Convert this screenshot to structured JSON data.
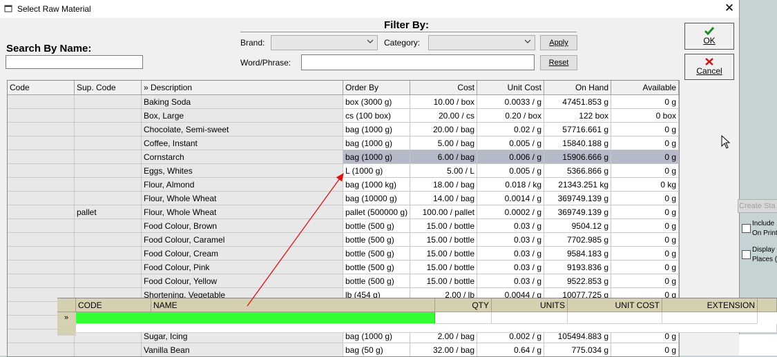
{
  "window": {
    "title": "Select Raw Material",
    "close_glyph": "✕"
  },
  "search": {
    "label": "Search By Name:",
    "value": ""
  },
  "filter": {
    "title": "Filter By:",
    "brand_label": "Brand:",
    "brand_value": "",
    "category_label": "Category:",
    "category_value": "",
    "word_label": "Word/Phrase:",
    "word_value": "",
    "apply_label": "Apply",
    "reset_label": "Reset"
  },
  "buttons": {
    "ok_label": "OK",
    "cancel_label": "Cancel"
  },
  "table": {
    "columns": [
      "Code",
      "Sup. Code",
      "» Description",
      "Order By",
      "Cost",
      "Unit Cost",
      "On Hand",
      "Available"
    ],
    "rows": [
      [
        "",
        "",
        "Baking Soda",
        "box (3000 g)",
        "10.00 / box",
        "0.0033 / g",
        "47451.853 g",
        "0 g"
      ],
      [
        "",
        "",
        "Box, Large",
        "cs (100 box)",
        "20.00 / cs",
        "0.20 / box",
        "122 box",
        "0 box"
      ],
      [
        "",
        "",
        "Chocolate, Semi-sweet",
        "bag (1000 g)",
        "20.00 / bag",
        "0.02 / g",
        "57716.661 g",
        "0 g"
      ],
      [
        "",
        "",
        "Coffee, Instant",
        "bag (1000 g)",
        "5.00 / bag",
        "0.005 / g",
        "15840.188 g",
        "0 g"
      ],
      [
        "",
        "",
        "Cornstarch",
        "bag (1000 g)",
        "6.00 / bag",
        "0.006 / g",
        "15906.666 g",
        "0 g"
      ],
      [
        "",
        "",
        "Eggs, Whites",
        "L (1000 g)",
        "5.00 / L",
        "0.005 / g",
        "5366.866 g",
        "0 g"
      ],
      [
        "",
        "",
        "Flour, Almond",
        "bag (1000 kg)",
        "18.00 / bag",
        "0.018 / kg",
        "21343.251 kg",
        "0 kg"
      ],
      [
        "",
        "",
        "Flour, Whole Wheat",
        "bag (10000 g)",
        "14.00 / bag",
        "0.0014 / g",
        "369749.139 g",
        "0 g"
      ],
      [
        "",
        "pallet",
        "Flour, Whole Wheat",
        "pallet (500000 g)",
        "100.00 / pallet",
        "0.0002 / g",
        "369749.139 g",
        "0 g"
      ],
      [
        "",
        "",
        "Food Colour, Brown",
        "bottle (500 g)",
        "15.00 / bottle",
        "0.03 / g",
        "9504.12 g",
        "0 g"
      ],
      [
        "",
        "",
        "Food Colour, Caramel",
        "bottle (500 g)",
        "15.00 / bottle",
        "0.03 / g",
        "7702.985 g",
        "0 g"
      ],
      [
        "",
        "",
        "Food Colour, Cream",
        "bottle (500 g)",
        "15.00 / bottle",
        "0.03 / g",
        "9584.183 g",
        "0 g"
      ],
      [
        "",
        "",
        "Food Colour, Pink",
        "bottle (500 g)",
        "15.00 / bottle",
        "0.03 / g",
        "9193.836 g",
        "0 g"
      ],
      [
        "",
        "",
        "Food Colour, Yellow",
        "bottle (500 g)",
        "15.00 / bottle",
        "0.03 / g",
        "9522.853 g",
        "0 g"
      ],
      [
        "",
        "",
        "Shortening, Vegetable",
        "lb (454 g)",
        "2.00 / lb",
        "0.0044 / g",
        "10077.725 g",
        "0 g"
      ],
      [
        "",
        "",
        "",
        "",
        "",
        "",
        "",
        ""
      ],
      [
        "",
        "",
        "",
        "",
        "",
        "",
        "",
        ""
      ],
      [
        "",
        "",
        "Sugar, Icing",
        "bag (1000 g)",
        "2.00 / bag",
        "0.002 / g",
        "105494.883 g",
        "0 g"
      ],
      [
        "",
        "",
        "Vanilla Bean",
        "bag (50 g)",
        "32.00 / bag",
        "0.64 / g",
        "775.034 g",
        "0 g"
      ]
    ],
    "selected_row": 4
  },
  "bottom_grid": {
    "columns": [
      "CODE",
      "NAME",
      "QTY",
      "UNITS",
      "UNIT COST",
      "EXTENSION"
    ],
    "row_marker": "»",
    "highlight_color": "#33ff33"
  },
  "right_panel": {
    "create_label": "Create Sta",
    "include_label_1": "Include",
    "include_label_2": "On Print",
    "display_label_1": "Display",
    "display_label_2": "Places ("
  },
  "colors": {
    "selected_row": "#b6b9c8",
    "arrow": "#e01010",
    "accent_green": "#33ff33"
  }
}
